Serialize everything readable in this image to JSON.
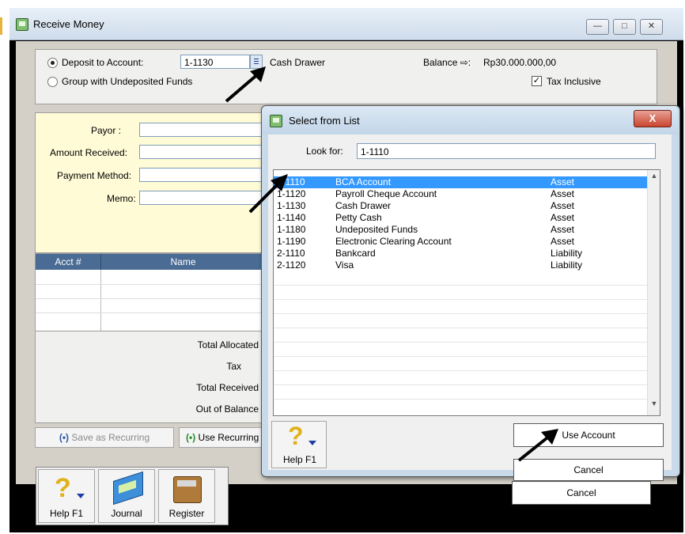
{
  "main": {
    "title": "Receive Money",
    "deposit_label": "Deposit to Account:",
    "deposit_account": "1-1130",
    "deposit_account_name": "Cash Drawer",
    "balance_label": "Balance ⇨:",
    "balance_value": "Rp30.000.000,00",
    "group_label": "Group with Undeposited Funds",
    "tax_inclusive_label": "Tax Inclusive",
    "payor_label": "Payor   :",
    "amount_label": "Amount Received:",
    "payment_method_label": "Payment Method:",
    "memo_label": "Memo:",
    "grid_headers": [
      "Acct #",
      "Name"
    ],
    "totals": [
      "Total Allocated",
      "Tax",
      "Total Received",
      "Out of Balance"
    ],
    "save_recurring_label": "Save as Recurring",
    "use_recurring_label": "Use Recurring",
    "toolbar": {
      "help": "Help F1",
      "journal": "Journal",
      "register": "Register"
    },
    "cancel_label": "Cancel"
  },
  "dialog": {
    "title": "Select from List",
    "look_for_label": "Look for:",
    "look_for_value": "1-1110",
    "accounts": [
      {
        "code": "1-1110",
        "name": "BCA Account",
        "type": "Asset"
      },
      {
        "code": "1-1120",
        "name": "Payroll Cheque Account",
        "type": "Asset"
      },
      {
        "code": "1-1130",
        "name": "Cash Drawer",
        "type": "Asset"
      },
      {
        "code": "1-1140",
        "name": "Petty Cash",
        "type": "Asset"
      },
      {
        "code": "1-1180",
        "name": "Undeposited Funds",
        "type": "Asset"
      },
      {
        "code": "1-1190",
        "name": "Electronic Clearing Account",
        "type": "Asset"
      },
      {
        "code": "2-1110",
        "name": "Bankcard",
        "type": "Liability"
      },
      {
        "code": "2-1120",
        "name": "Visa",
        "type": "Liability"
      }
    ],
    "help_label": "Help F1",
    "use_account_label": "Use Account",
    "cancel_label": "Cancel",
    "close_glyph": "X"
  },
  "colors": {
    "selection": "#3399ff",
    "grid_header": "#4a6c94",
    "form_yellow": "#fffbd6",
    "arrow": "#000000"
  },
  "icons": [
    "window-icon",
    "dropdown-list-icon",
    "help-question-icon",
    "journal-icon",
    "register-icon",
    "scroll-up-icon",
    "scroll-down-icon",
    "pointer-arrow-icon"
  ]
}
